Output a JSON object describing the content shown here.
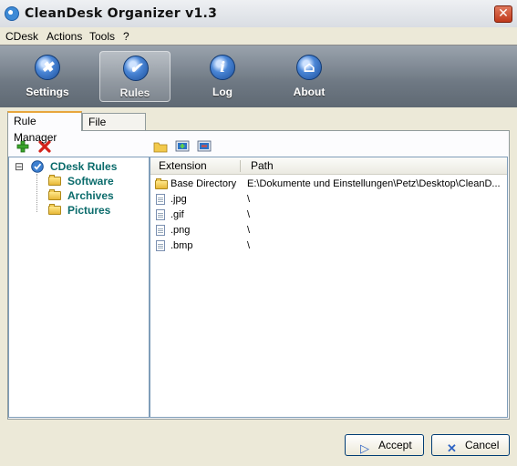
{
  "window": {
    "title": "CleanDesk Organizer v1.3",
    "close_glyph": "✕"
  },
  "menu": [
    {
      "label": "CDesk"
    },
    {
      "label": "Actions"
    },
    {
      "label": "Tools"
    },
    {
      "label": "?"
    }
  ],
  "toolbar": {
    "items": [
      {
        "label": "Settings",
        "icon": "settings-icon",
        "glyph": "✖"
      },
      {
        "label": "Rules",
        "icon": "rules-check-icon",
        "glyph": "✔",
        "active": true
      },
      {
        "label": "Log",
        "icon": "info-icon",
        "glyph": "i"
      },
      {
        "label": "About",
        "icon": "about-icon",
        "glyph": "⌂"
      }
    ]
  },
  "tabs": [
    {
      "label": "Rule Manager",
      "active": true
    },
    {
      "label": "File Manager",
      "active": false
    }
  ],
  "rule_tree": {
    "expander": "⊟",
    "root": "CDesk Rules",
    "children": [
      "Software",
      "Archives",
      "Pictures"
    ]
  },
  "list": {
    "columns": [
      "Extension",
      "Path"
    ],
    "rows": [
      {
        "extension": "Base Directory",
        "path": "E:\\Dokumente und Einstellungen\\Petz\\Desktop\\CleanD...",
        "icon": "folder-icon"
      },
      {
        "extension": ".jpg",
        "path": "\\",
        "icon": "file-icon"
      },
      {
        "extension": ".gif",
        "path": "\\",
        "icon": "file-icon"
      },
      {
        "extension": ".png",
        "path": "\\",
        "icon": "file-icon"
      },
      {
        "extension": ".bmp",
        "path": "\\",
        "icon": "file-icon"
      }
    ]
  },
  "buttons": {
    "accept": {
      "label": "Accept",
      "glyph": "▷"
    },
    "cancel": {
      "label": "Cancel",
      "glyph": "✕"
    }
  },
  "colors": {
    "tree_text": "#0a6b6b",
    "tab_accent": "#e8a63d",
    "toolbar": "#6e7883"
  }
}
